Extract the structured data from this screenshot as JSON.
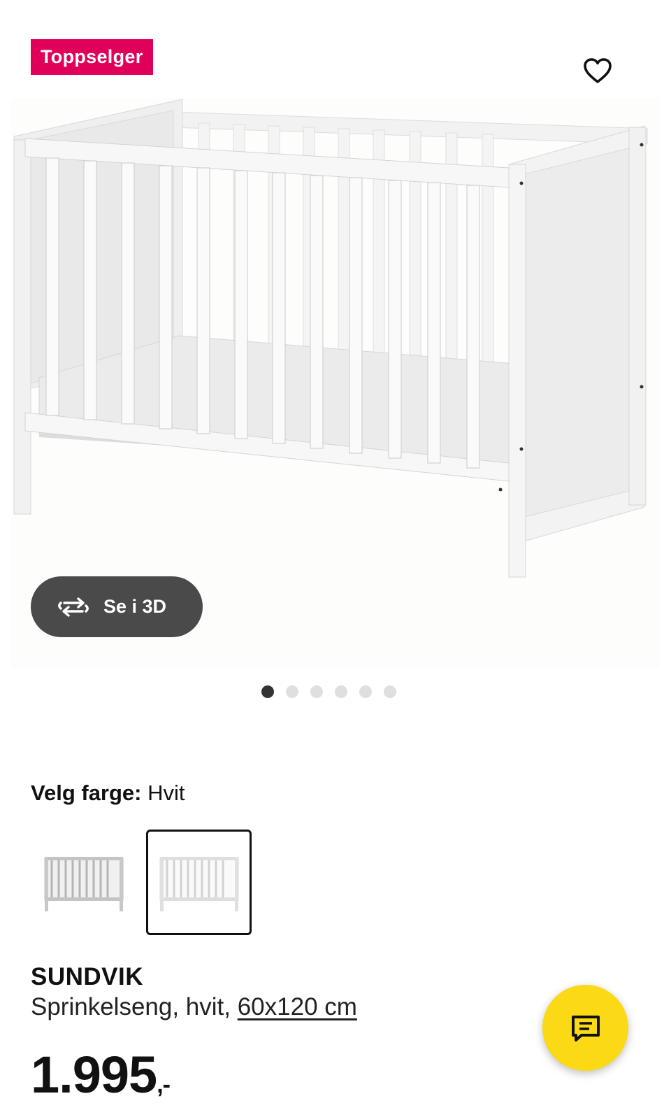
{
  "badge": {
    "text": "Toppselger"
  },
  "icons": {
    "favorite": "heart-outline-icon",
    "rotate": "rotate-3d-icon",
    "chat": "chat-bubble-icon"
  },
  "gallery": {
    "view_3d_label": "Se i 3D",
    "image_count": 6,
    "active_index": 0
  },
  "color_picker": {
    "label": "Velg farge:",
    "selected": "Hvit",
    "options": [
      {
        "name": "grey-white-variant",
        "selected": false
      },
      {
        "name": "white-variant",
        "selected": true
      }
    ]
  },
  "product": {
    "name": "SUNDVIK",
    "description": "Sprinkelseng, hvit, ",
    "size_link": "60x120 cm",
    "price": "1.995",
    "price_suffix": ",-"
  },
  "colors": {
    "badge_bg": "#e0005a",
    "chat_bg": "#fbd914",
    "button_3d_bg": "#4a4a4a"
  }
}
